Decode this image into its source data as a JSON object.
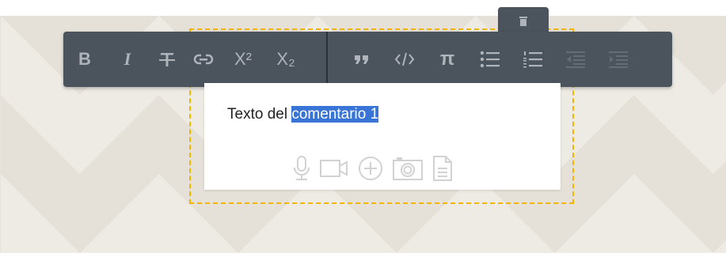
{
  "comment": {
    "text_plain": "Texto del ",
    "text_selected": "comentario 1"
  },
  "toolbar": {
    "bold_label": "B",
    "italic_label": "I",
    "superscript_label": "X²",
    "subscript_label": "X₂",
    "pi_label": "π"
  },
  "colors": {
    "toolbar_bg": "#4b535d",
    "icon": "#aeb4ba",
    "frame": "#f5b400",
    "selection": "#3875d7"
  }
}
